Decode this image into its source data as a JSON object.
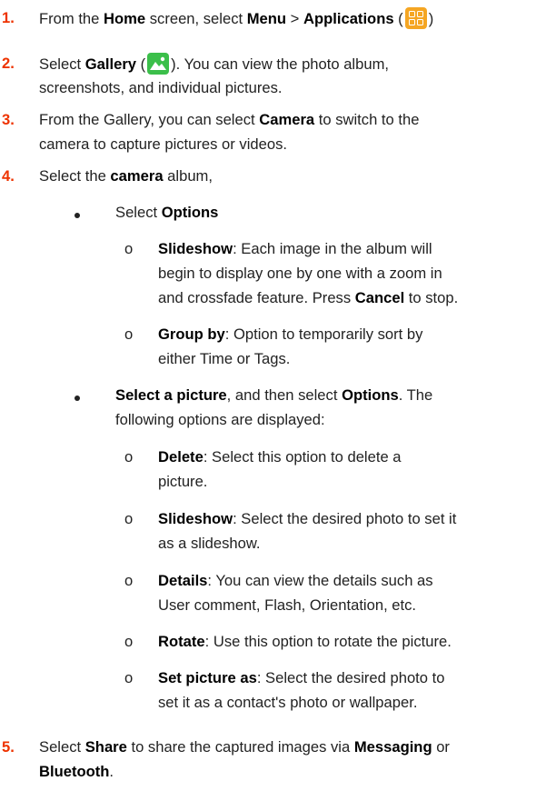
{
  "steps": [
    {
      "num": "1.",
      "p1": "From the ",
      "home": "Home",
      "p2": " screen, select ",
      "menu": "Menu",
      "p3": " > ",
      "apps": "Applications",
      "p4": " (",
      "p5": ")"
    },
    {
      "num": "2.",
      "p1": "Select ",
      "gallery": "Gallery",
      "p2": " (",
      "p3": "). You can view the photo album,",
      "l2": "screenshots, and individual pictures."
    },
    {
      "num": "3.",
      "p1": "From the Gallery, you can select ",
      "camera": "Camera",
      "p2": " to switch to the",
      "l2": "camera to capture pictures or videos."
    },
    {
      "num": "4.",
      "p1": "Select the ",
      "camera": "camera",
      "p2": " album,"
    },
    {
      "num": "5.",
      "p1": "Select ",
      "share": "Share",
      "p2": " to share the captured images via ",
      "messaging": "Messaging",
      "p3": " or",
      "bluetooth": "Bluetooth",
      "p4": "."
    }
  ],
  "bullet1": {
    "p1": "Select ",
    "options": "Options"
  },
  "slideshow1": {
    "title": "Slideshow",
    "p1": ": Each image in the album will",
    "l2": "begin to display one by one with a zoom in",
    "l3a": "and crossfade feature. Press ",
    "cancel": "Cancel",
    "l3b": " to stop."
  },
  "groupby": {
    "title": "Group by",
    "p1": ": Option to temporarily sort by",
    "l2": "either Time or Tags."
  },
  "bullet2": {
    "pic": "Select a picture",
    "p1": ", and then select ",
    "options": "Options",
    "p2": ". The",
    "l2": "following options are displayed:"
  },
  "sub_marker": "o",
  "subitems": [
    {
      "title": "Delete",
      "p1": ": Select this option to delete a",
      "l2": "picture."
    },
    {
      "title": "Slideshow",
      "p1": ": Select the desired photo to set it",
      "l2": "as a slideshow."
    },
    {
      "title": "Details",
      "p1": ": You can view the details such as",
      "l2": "User comment, Flash, Orientation, etc."
    },
    {
      "title": "Rotate",
      "p1": ": Use this option to rotate the picture.",
      "l2": ""
    },
    {
      "title": "Set picture as",
      "p1": ": Select the desired photo to",
      "l2": "set it as a contact's photo or wallpaper."
    }
  ],
  "colors": {
    "step_number": "#ee3300",
    "app_icon": "#f5a623",
    "gallery_icon": "#3bbf4a"
  },
  "icons": [
    "applications-icon",
    "gallery-icon"
  ]
}
